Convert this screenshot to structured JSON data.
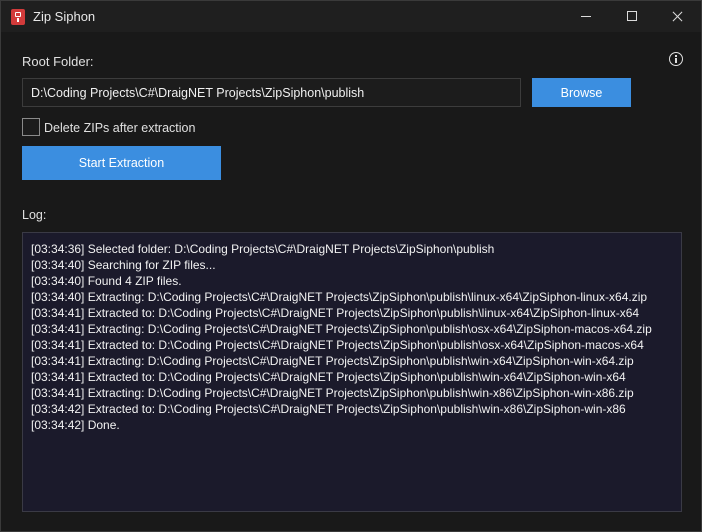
{
  "window": {
    "title": "Zip Siphon"
  },
  "form": {
    "root_label": "Root Folder:",
    "root_path": "D:\\Coding Projects\\C#\\DraigNET Projects\\ZipSiphon\\publish",
    "browse_label": "Browse",
    "delete_zips_label": "Delete ZIPs after extraction",
    "delete_zips_checked": false,
    "start_label": "Start Extraction"
  },
  "log": {
    "label": "Log:",
    "lines": [
      "[03:34:36] Selected folder: D:\\Coding Projects\\C#\\DraigNET Projects\\ZipSiphon\\publish",
      "[03:34:40] Searching for ZIP files...",
      "[03:34:40] Found 4 ZIP files.",
      "[03:34:40] Extracting: D:\\Coding Projects\\C#\\DraigNET Projects\\ZipSiphon\\publish\\linux-x64\\ZipSiphon-linux-x64.zip",
      "[03:34:41] Extracted to: D:\\Coding Projects\\C#\\DraigNET Projects\\ZipSiphon\\publish\\linux-x64\\ZipSiphon-linux-x64",
      "[03:34:41] Extracting: D:\\Coding Projects\\C#\\DraigNET Projects\\ZipSiphon\\publish\\osx-x64\\ZipSiphon-macos-x64.zip",
      "[03:34:41] Extracted to: D:\\Coding Projects\\C#\\DraigNET Projects\\ZipSiphon\\publish\\osx-x64\\ZipSiphon-macos-x64",
      "[03:34:41] Extracting: D:\\Coding Projects\\C#\\DraigNET Projects\\ZipSiphon\\publish\\win-x64\\ZipSiphon-win-x64.zip",
      "[03:34:41] Extracted to: D:\\Coding Projects\\C#\\DraigNET Projects\\ZipSiphon\\publish\\win-x64\\ZipSiphon-win-x64",
      "[03:34:41] Extracting: D:\\Coding Projects\\C#\\DraigNET Projects\\ZipSiphon\\publish\\win-x86\\ZipSiphon-win-x86.zip",
      "[03:34:42] Extracted to: D:\\Coding Projects\\C#\\DraigNET Projects\\ZipSiphon\\publish\\win-x86\\ZipSiphon-win-x86",
      "[03:34:42] Done."
    ]
  },
  "icons": {
    "app": "zip-icon",
    "info": "info-icon",
    "minimize": "minimize-icon",
    "maximize": "maximize-icon",
    "close": "close-icon"
  },
  "colors": {
    "accent": "#3b8ee0",
    "log_background": "#1b1a2b",
    "window_background": "#191919"
  }
}
